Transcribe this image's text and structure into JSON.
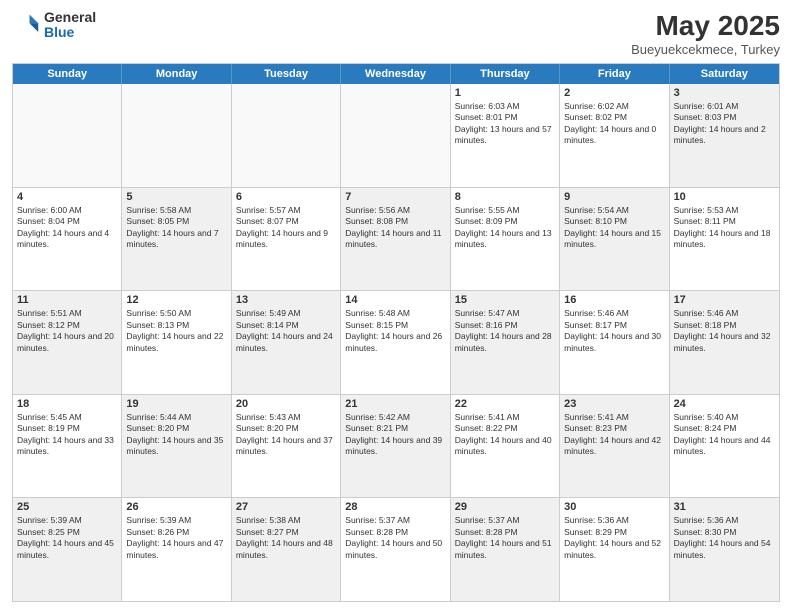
{
  "header": {
    "logo_general": "General",
    "logo_blue": "Blue",
    "month_year": "May 2025",
    "location": "Bueyuekcekmece, Turkey"
  },
  "days_of_week": [
    "Sunday",
    "Monday",
    "Tuesday",
    "Wednesday",
    "Thursday",
    "Friday",
    "Saturday"
  ],
  "weeks": [
    [
      {
        "day": "",
        "text": "",
        "empty": true
      },
      {
        "day": "",
        "text": "",
        "empty": true
      },
      {
        "day": "",
        "text": "",
        "empty": true
      },
      {
        "day": "",
        "text": "",
        "empty": true
      },
      {
        "day": "1",
        "text": "Sunrise: 6:03 AM\nSunset: 8:01 PM\nDaylight: 13 hours and 57 minutes.",
        "empty": false
      },
      {
        "day": "2",
        "text": "Sunrise: 6:02 AM\nSunset: 8:02 PM\nDaylight: 14 hours and 0 minutes.",
        "empty": false
      },
      {
        "day": "3",
        "text": "Sunrise: 6:01 AM\nSunset: 8:03 PM\nDaylight: 14 hours and 2 minutes.",
        "empty": false,
        "shaded": true
      }
    ],
    [
      {
        "day": "4",
        "text": "Sunrise: 6:00 AM\nSunset: 8:04 PM\nDaylight: 14 hours and 4 minutes.",
        "empty": false
      },
      {
        "day": "5",
        "text": "Sunrise: 5:58 AM\nSunset: 8:05 PM\nDaylight: 14 hours and 7 minutes.",
        "empty": false,
        "shaded": true
      },
      {
        "day": "6",
        "text": "Sunrise: 5:57 AM\nSunset: 8:07 PM\nDaylight: 14 hours and 9 minutes.",
        "empty": false
      },
      {
        "day": "7",
        "text": "Sunrise: 5:56 AM\nSunset: 8:08 PM\nDaylight: 14 hours and 11 minutes.",
        "empty": false,
        "shaded": true
      },
      {
        "day": "8",
        "text": "Sunrise: 5:55 AM\nSunset: 8:09 PM\nDaylight: 14 hours and 13 minutes.",
        "empty": false
      },
      {
        "day": "9",
        "text": "Sunrise: 5:54 AM\nSunset: 8:10 PM\nDaylight: 14 hours and 15 minutes.",
        "empty": false,
        "shaded": true
      },
      {
        "day": "10",
        "text": "Sunrise: 5:53 AM\nSunset: 8:11 PM\nDaylight: 14 hours and 18 minutes.",
        "empty": false
      }
    ],
    [
      {
        "day": "11",
        "text": "Sunrise: 5:51 AM\nSunset: 8:12 PM\nDaylight: 14 hours and 20 minutes.",
        "empty": false,
        "shaded": true
      },
      {
        "day": "12",
        "text": "Sunrise: 5:50 AM\nSunset: 8:13 PM\nDaylight: 14 hours and 22 minutes.",
        "empty": false
      },
      {
        "day": "13",
        "text": "Sunrise: 5:49 AM\nSunset: 8:14 PM\nDaylight: 14 hours and 24 minutes.",
        "empty": false,
        "shaded": true
      },
      {
        "day": "14",
        "text": "Sunrise: 5:48 AM\nSunset: 8:15 PM\nDaylight: 14 hours and 26 minutes.",
        "empty": false
      },
      {
        "day": "15",
        "text": "Sunrise: 5:47 AM\nSunset: 8:16 PM\nDaylight: 14 hours and 28 minutes.",
        "empty": false,
        "shaded": true
      },
      {
        "day": "16",
        "text": "Sunrise: 5:46 AM\nSunset: 8:17 PM\nDaylight: 14 hours and 30 minutes.",
        "empty": false
      },
      {
        "day": "17",
        "text": "Sunrise: 5:46 AM\nSunset: 8:18 PM\nDaylight: 14 hours and 32 minutes.",
        "empty": false,
        "shaded": true
      }
    ],
    [
      {
        "day": "18",
        "text": "Sunrise: 5:45 AM\nSunset: 8:19 PM\nDaylight: 14 hours and 33 minutes.",
        "empty": false
      },
      {
        "day": "19",
        "text": "Sunrise: 5:44 AM\nSunset: 8:20 PM\nDaylight: 14 hours and 35 minutes.",
        "empty": false,
        "shaded": true
      },
      {
        "day": "20",
        "text": "Sunrise: 5:43 AM\nSunset: 8:20 PM\nDaylight: 14 hours and 37 minutes.",
        "empty": false
      },
      {
        "day": "21",
        "text": "Sunrise: 5:42 AM\nSunset: 8:21 PM\nDaylight: 14 hours and 39 minutes.",
        "empty": false,
        "shaded": true
      },
      {
        "day": "22",
        "text": "Sunrise: 5:41 AM\nSunset: 8:22 PM\nDaylight: 14 hours and 40 minutes.",
        "empty": false
      },
      {
        "day": "23",
        "text": "Sunrise: 5:41 AM\nSunset: 8:23 PM\nDaylight: 14 hours and 42 minutes.",
        "empty": false,
        "shaded": true
      },
      {
        "day": "24",
        "text": "Sunrise: 5:40 AM\nSunset: 8:24 PM\nDaylight: 14 hours and 44 minutes.",
        "empty": false
      }
    ],
    [
      {
        "day": "25",
        "text": "Sunrise: 5:39 AM\nSunset: 8:25 PM\nDaylight: 14 hours and 45 minutes.",
        "empty": false,
        "shaded": true
      },
      {
        "day": "26",
        "text": "Sunrise: 5:39 AM\nSunset: 8:26 PM\nDaylight: 14 hours and 47 minutes.",
        "empty": false
      },
      {
        "day": "27",
        "text": "Sunrise: 5:38 AM\nSunset: 8:27 PM\nDaylight: 14 hours and 48 minutes.",
        "empty": false,
        "shaded": true
      },
      {
        "day": "28",
        "text": "Sunrise: 5:37 AM\nSunset: 8:28 PM\nDaylight: 14 hours and 50 minutes.",
        "empty": false
      },
      {
        "day": "29",
        "text": "Sunrise: 5:37 AM\nSunset: 8:28 PM\nDaylight: 14 hours and 51 minutes.",
        "empty": false,
        "shaded": true
      },
      {
        "day": "30",
        "text": "Sunrise: 5:36 AM\nSunset: 8:29 PM\nDaylight: 14 hours and 52 minutes.",
        "empty": false
      },
      {
        "day": "31",
        "text": "Sunrise: 5:36 AM\nSunset: 8:30 PM\nDaylight: 14 hours and 54 minutes.",
        "empty": false,
        "shaded": true
      }
    ]
  ]
}
